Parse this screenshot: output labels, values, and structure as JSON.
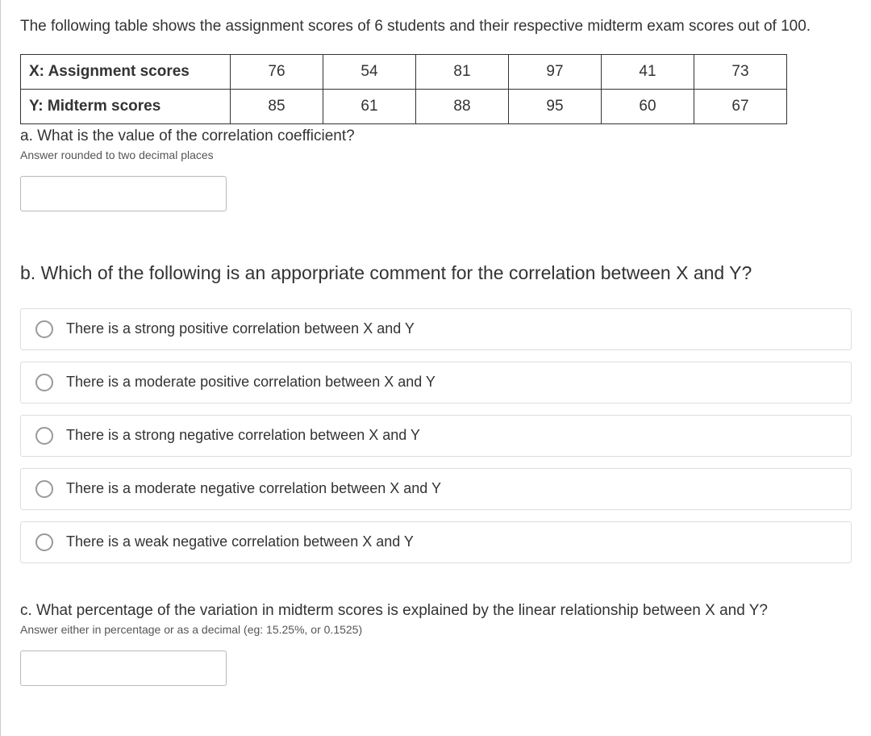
{
  "intro": "The following table shows the assignment scores of 6 students and their respective midterm exam scores out of 100.",
  "table": {
    "rows": [
      {
        "label": "X: Assignment scores",
        "values": [
          "76",
          "54",
          "81",
          "97",
          "41",
          "73"
        ]
      },
      {
        "label": "Y: Midterm scores",
        "values": [
          "85",
          "61",
          "88",
          "95",
          "60",
          "67"
        ]
      }
    ]
  },
  "qa": {
    "prompt": "a. What is the value of the correlation coefficient?",
    "hint": "Answer rounded to two decimal places",
    "value": ""
  },
  "qb": {
    "prompt": "b. Which of the following is an apporpriate comment for the correlation between X and Y?",
    "options": [
      "There is a strong positive correlation between X and Y",
      "There is a moderate positive correlation between X and Y",
      "There is a strong negative correlation between X and Y",
      "There is a moderate negative correlation between X and Y",
      "There is a weak negative correlation between X and Y"
    ]
  },
  "qc": {
    "prompt": "c. What percentage of the variation in midterm scores is explained by the linear relationship between X and Y?",
    "hint": "Answer either in percentage or as a decimal (eg: 15.25%, or 0.1525)",
    "value": ""
  }
}
